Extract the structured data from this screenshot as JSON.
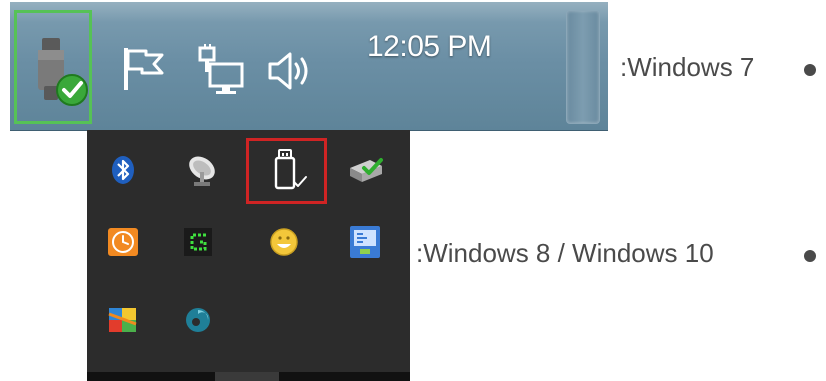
{
  "windows7": {
    "clock": "12:05 PM",
    "label": ":Windows 7",
    "icons": [
      "usb-safely-remove-icon",
      "action-center-flag-icon",
      "network-icon",
      "volume-icon"
    ]
  },
  "windows8_10": {
    "label": ":Windows 8 / Windows 10",
    "icons": [
      "bluetooth-icon",
      "satellite-dish-icon",
      "usb-drive-icon",
      "hardware-check-icon",
      "orange-clock-icon",
      "green-g-icon",
      "yellow-face-icon",
      "blue-monitor-icon",
      "avg-icon",
      "teal-swirl-icon"
    ]
  },
  "colors": {
    "win7_highlight": "#56c256",
    "win8_highlight": "#d02424",
    "tray_background": "#2c2c2c",
    "label_text": "#4a4a4a"
  }
}
